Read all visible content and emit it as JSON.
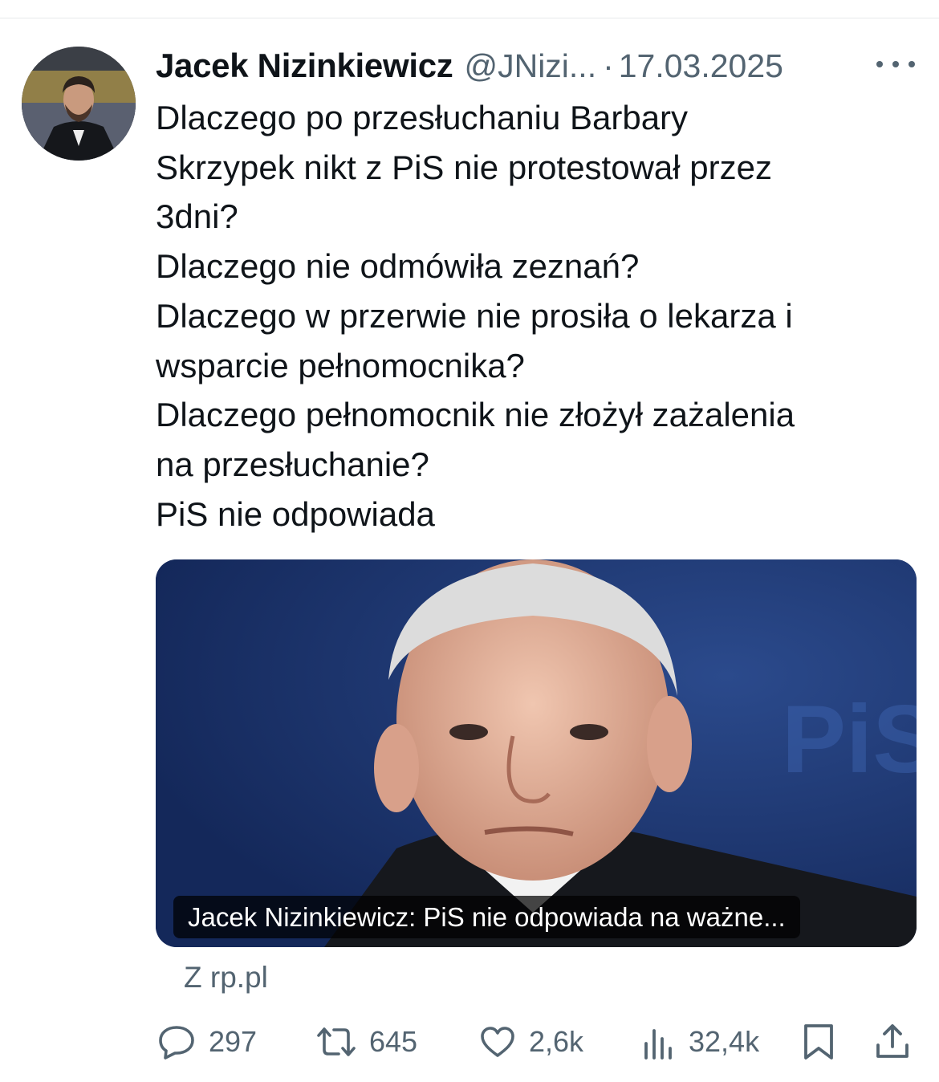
{
  "tweet": {
    "author_name": "Jacek Nizinkiewicz",
    "handle": "@JNizi...",
    "separator": "·",
    "date": "17.03.2025",
    "lines": [
      "Dlaczego po przesłuchaniu Barbary",
      "Skrzypek nikt z PiS nie protestował przez",
      "3dni?",
      "Dlaczego nie odmówiła zeznań?",
      "Dlaczego w przerwie nie prosiła o lekarza i",
      "wsparcie pełnomocnika?",
      "Dlaczego pełnomocnik nie złożył zażalenia",
      "na przesłuchanie?",
      "PiS nie odpowiada"
    ]
  },
  "card": {
    "caption": "Jacek Nizinkiewicz: PiS nie odpowiada na ważne...",
    "source": "Z rp.pl",
    "background_text": "PiS"
  },
  "actions": {
    "replies": "297",
    "reposts": "645",
    "likes": "2,6k",
    "views": "32,4k"
  },
  "icons": [
    "more-icon",
    "reply-icon",
    "repost-icon",
    "like-icon",
    "views-icon",
    "bookmark-icon",
    "share-icon"
  ],
  "colors": {
    "secondary_text": "#536471",
    "primary_text": "#0f1419"
  }
}
